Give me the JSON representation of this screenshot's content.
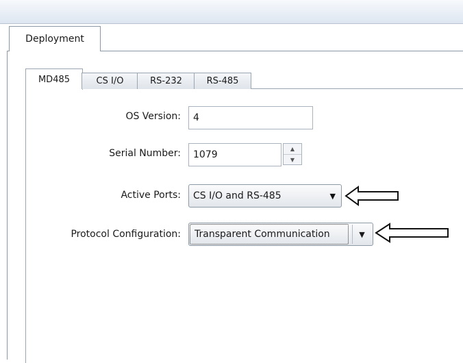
{
  "outer_tab": {
    "label": "Deployment"
  },
  "inner_tabs": [
    {
      "label": "MD485",
      "active": true
    },
    {
      "label": "CS I/O",
      "active": false
    },
    {
      "label": "RS-232",
      "active": false
    },
    {
      "label": "RS-485",
      "active": false
    }
  ],
  "form": {
    "os_version": {
      "label": "OS Version:",
      "value": "4"
    },
    "serial_number": {
      "label": "Serial Number:",
      "value": "1079"
    },
    "active_ports": {
      "label": "Active Ports:",
      "value": "CS I/O and RS-485"
    },
    "protocol_configuration": {
      "label": "Protocol Configuration:",
      "value": "Transparent Communication"
    }
  },
  "icons": {
    "spinner_up": "triangle-up",
    "spinner_down": "triangle-down",
    "dropdown": "caret-down",
    "pointer": "arrow-left"
  }
}
